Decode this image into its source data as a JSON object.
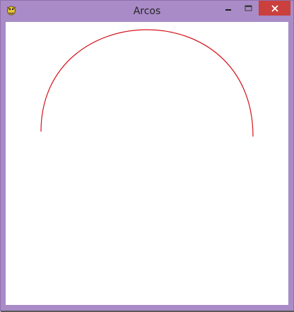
{
  "window": {
    "title": "Arcos",
    "app_icon": "pygame-snake-icon"
  },
  "titlebar_buttons": [
    {
      "name": "minimize",
      "icon": "minimize-icon"
    },
    {
      "name": "maximize",
      "icon": "maximize-icon"
    },
    {
      "name": "close",
      "icon": "close-icon"
    }
  ],
  "colors": {
    "titlebar": "#a98bc7",
    "close_button": "#c9403d",
    "canvas_background": "#ffffff",
    "arc_stroke": "#d4141c"
  }
}
